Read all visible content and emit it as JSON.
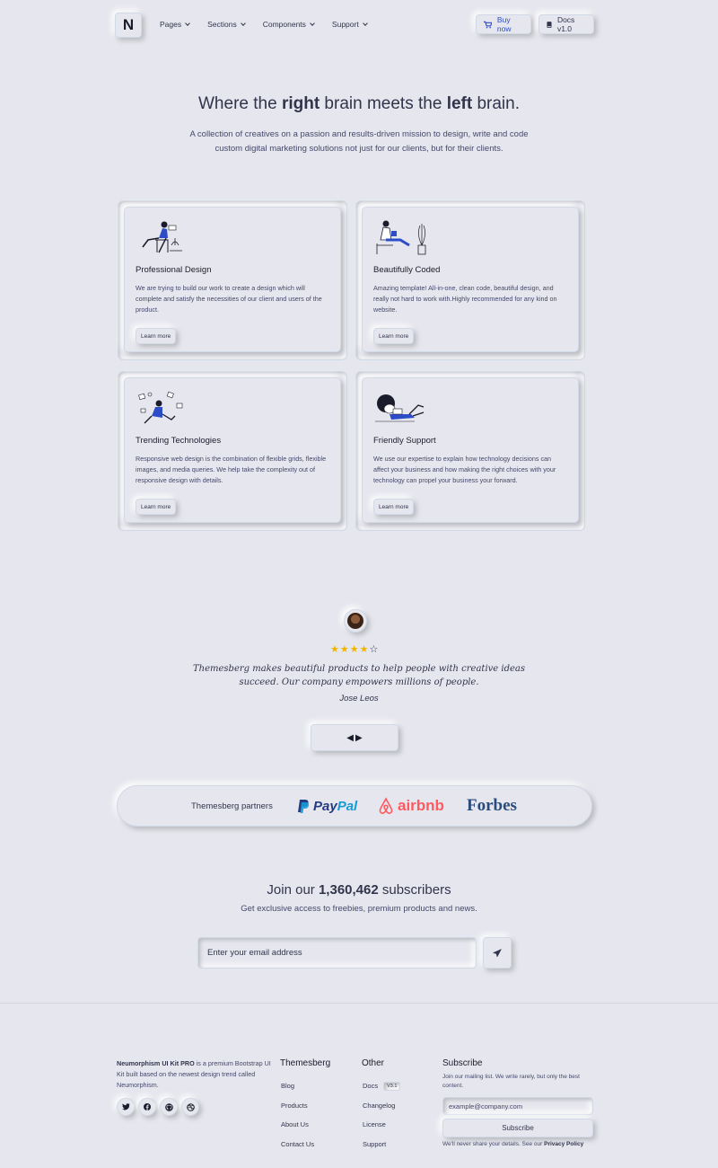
{
  "nav": {
    "brand": "N",
    "links": [
      "Pages",
      "Sections",
      "Components",
      "Support"
    ],
    "buy_label": "Buy now",
    "docs_label": "Docs v1.0"
  },
  "hero": {
    "title_pre": "Where the ",
    "title_bold1": "right",
    "title_mid": " brain meets the ",
    "title_bold2": "left",
    "title_post": " brain.",
    "subtitle": "A collection of creatives on a passion and results-driven mission to design, write and code custom digital marketing solutions not just for our clients, but for their clients."
  },
  "features": [
    {
      "title": "Professional Design",
      "desc": "We are trying to build our work to create a design which will complete and satisfy the necessities of our client and users of the product.",
      "cta": "Learn more",
      "illustration": "person-chair-illustration"
    },
    {
      "title": "Beautifully Coded",
      "desc": "Amazing template! All-in-one, clean code, beautiful design, and really not hard to work with.Highly recommended for any kind on website.",
      "cta": "Learn more",
      "illustration": "person-reading-plant-illustration"
    },
    {
      "title": "Trending Technologies",
      "desc": "Responsive web design is the combination of flexible grids, flexible images, and media queries. We help take the complexity out of responsive design with details.",
      "cta": "Learn more",
      "illustration": "person-floating-papers-illustration"
    },
    {
      "title": "Friendly Support",
      "desc": "We use our expertise to explain how technology decisions can affect your business and how making the right choices with your technology can propel your business your forward.",
      "cta": "Learn more",
      "illustration": "person-lying-laptop-illustration"
    }
  ],
  "testimonial": {
    "rating": 4,
    "max_rating": 5,
    "quote": "Themesberg makes beautiful products to help people with creative ideas succeed. Our company empowers millions of people.",
    "author": "Jose Leos"
  },
  "partners": {
    "label": "Themesberg partners",
    "logos": [
      "PayPal",
      "airbnb",
      "Forbes"
    ],
    "paypal_a": "Pay",
    "paypal_b": "Pal"
  },
  "subscribe": {
    "title_pre": "Join our ",
    "count": "1,360,462",
    "title_post": " subscribers",
    "text": "Get exclusive access to freebies, premium products and news.",
    "placeholder": "Enter your email address"
  },
  "footer": {
    "about_brand": "Neumorphism UI Kit PRO",
    "about_text": " is a premium Bootstrap UI Kit built based on the newest design trend called Neumorphism.",
    "socials": [
      "twitter-icon",
      "facebook-icon",
      "github-icon",
      "dribbble-icon"
    ],
    "col1": {
      "title": "Themesberg",
      "links": [
        "Blog",
        "Products",
        "About Us",
        "Contact Us"
      ]
    },
    "col2": {
      "title": "Other",
      "links": [
        "Docs",
        "Changelog",
        "License",
        "Support"
      ],
      "docs_badge": "V3.1"
    },
    "subscribe": {
      "title": "Subscribe",
      "text": "Join our mailing list. We write rarely, but only the best content.",
      "placeholder": "example@company.com",
      "button": "Subscribe",
      "privacy_pre": "We'll never share your details. See our ",
      "privacy_link": "Privacy Policy"
    }
  },
  "colors": {
    "background": "#e6e7ee",
    "accent": "#2d4cc8",
    "star": "#f0b400"
  }
}
